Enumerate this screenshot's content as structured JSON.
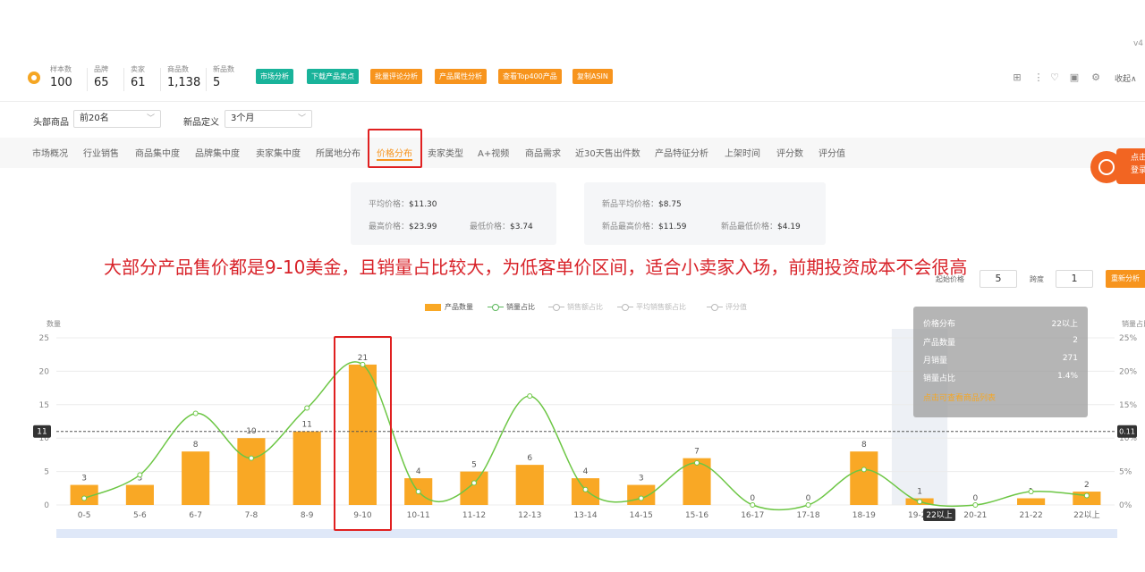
{
  "version": "v4",
  "stats": [
    {
      "label": "样本数",
      "value": "100"
    },
    {
      "label": "品牌",
      "value": "65"
    },
    {
      "label": "卖家",
      "value": "61"
    },
    {
      "label": "商品数",
      "value": "1,138"
    },
    {
      "label": "新品数",
      "value": "5"
    }
  ],
  "toolbar_buttons": [
    {
      "label": "市场分析",
      "color": "#19b39a"
    },
    {
      "label": "下载产品卖点",
      "color": "#19b39a"
    },
    {
      "label": "批量评论分析",
      "color": "#f7941d"
    },
    {
      "label": "产品属性分析",
      "color": "#f7941d"
    },
    {
      "label": "查看Top400产品",
      "color": "#f7941d"
    },
    {
      "label": "复制ASIN",
      "color": "#f7941d"
    }
  ],
  "top_icons": [
    "grid-icon",
    "more-vertical-icon",
    "heart-icon",
    "play-icon",
    "settings-icon"
  ],
  "collapse_label": "收起∧",
  "filters": {
    "head_label": "头部商品",
    "head_value": "前20名",
    "new_label": "新品定义",
    "new_value": "3个月"
  },
  "tabs": [
    "市场概况",
    "行业销售",
    "商品集中度",
    "品牌集中度",
    "卖家集中度",
    "所属地分布",
    "价格分布",
    "卖家类型",
    "A+视频",
    "商品需求",
    "近30天售出件数",
    "产品特征分析",
    "上架时间",
    "评分数",
    "评分值"
  ],
  "active_tab": "价格分布",
  "float_tag": {
    "line1": "点击",
    "line2": "登录"
  },
  "summary_left": {
    "avg_label": "平均价格：",
    "avg": "$11.30",
    "max_label": "最高价格：",
    "max": "$23.99",
    "min_label": "最低价格：",
    "min": "$3.74"
  },
  "summary_right": {
    "avg_label": "新品平均价格：",
    "avg": "$8.75",
    "max_label": "新品最高价格：",
    "max": "$11.59",
    "min_label": "新品最低价格：",
    "min": "$4.19"
  },
  "annotation": "大部分产品售价都是9-10美金，且销量占比较大，为低客单价区间，适合小卖家入场，前期投资成本不会很高",
  "controls": {
    "start_label": "起始价格",
    "start": "5",
    "span_label": "跨度",
    "span": "1",
    "refresh": "重新分析"
  },
  "legend": [
    "产品数量",
    "销量占比",
    "销售额占比",
    "平均销售额占比",
    "评分值"
  ],
  "tooltip": {
    "title_label": "价格分布",
    "title_value": "22以上",
    "rows": [
      {
        "label": "产品数量",
        "value": "2"
      },
      {
        "label": "月销量",
        "value": "271"
      },
      {
        "label": "销量占比",
        "value": "1.4%"
      }
    ],
    "link": "点击可查看商品列表"
  },
  "chart_data": {
    "type": "bar",
    "categories": [
      "0-5",
      "5-6",
      "6-7",
      "7-8",
      "8-9",
      "9-10",
      "10-11",
      "11-12",
      "12-13",
      "13-14",
      "14-15",
      "15-16",
      "16-17",
      "17-18",
      "18-19",
      "19-20",
      "20-21",
      "21-22",
      "22以上"
    ],
    "series": [
      {
        "name": "产品数量",
        "type": "bar",
        "axis": "left",
        "color": "#f9a825",
        "values": [
          3,
          3,
          8,
          10,
          11,
          21,
          4,
          5,
          6,
          4,
          3,
          7,
          0,
          0,
          8,
          1,
          0,
          1,
          2
        ]
      },
      {
        "name": "销量占比",
        "type": "line",
        "axis": "right",
        "unit": "%",
        "color": "#6cc644",
        "values": [
          1,
          4.5,
          13.7,
          7,
          14.5,
          21,
          2,
          3.3,
          16.3,
          2.3,
          1,
          6.3,
          0,
          0,
          5.3,
          0.5,
          0,
          2,
          1.4
        ]
      }
    ],
    "ylabel": "数量",
    "ylabel_right": "销量占比",
    "ylim": [
      0,
      25
    ],
    "yticks": [
      0,
      5,
      10,
      15,
      20,
      25
    ],
    "ylim_right": [
      0,
      25
    ],
    "yticks_right": [
      "0%",
      "5%",
      "10%",
      "15%",
      "20%",
      "25%"
    ],
    "average_line": {
      "left_label": "11",
      "right_label": "0.11",
      "value": 11
    },
    "highlighted_category": "19-20",
    "axis_pointer_label": "22以上"
  }
}
